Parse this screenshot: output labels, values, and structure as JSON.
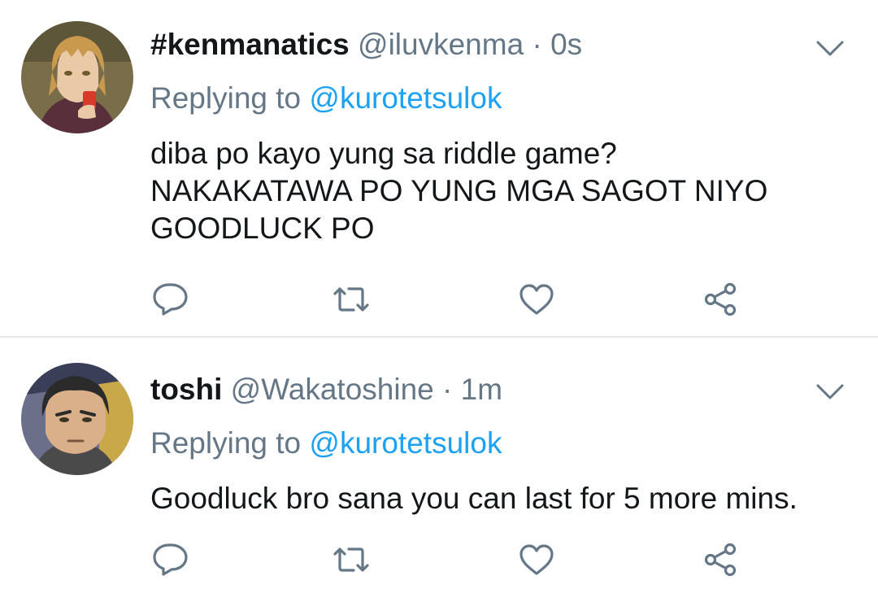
{
  "tweets": [
    {
      "display_name": "#kenmanatics",
      "handle": "@iluvkenma",
      "separator": "·",
      "time": "0s",
      "replying_prefix": "Replying to ",
      "replying_to": "@kurotetsulok",
      "text_lines": [
        "diba po kayo yung sa riddle game?",
        "NAKAKATAWA PO YUNG MGA SAGOT NIYO",
        "GOODLUCK PO"
      ],
      "avatar": "kenma-avatar"
    },
    {
      "display_name": "toshi",
      "handle": "@Wakatoshine",
      "separator": "·",
      "time": "1m",
      "replying_prefix": "Replying to ",
      "replying_to": "@kurotetsulok",
      "text_lines": [
        "Goodluck bro sana you can last for 5 more mins."
      ],
      "avatar": "wakatoshi-avatar"
    }
  ],
  "icons": {
    "reply": "reply-icon",
    "retweet": "retweet-icon",
    "like": "heart-icon",
    "share": "share-icon",
    "menu": "chevron-down-icon"
  },
  "colors": {
    "text": "#14171a",
    "secondary": "#657786",
    "link": "#1da1f2",
    "icon": "#657786",
    "divider": "#e1e8ed"
  }
}
